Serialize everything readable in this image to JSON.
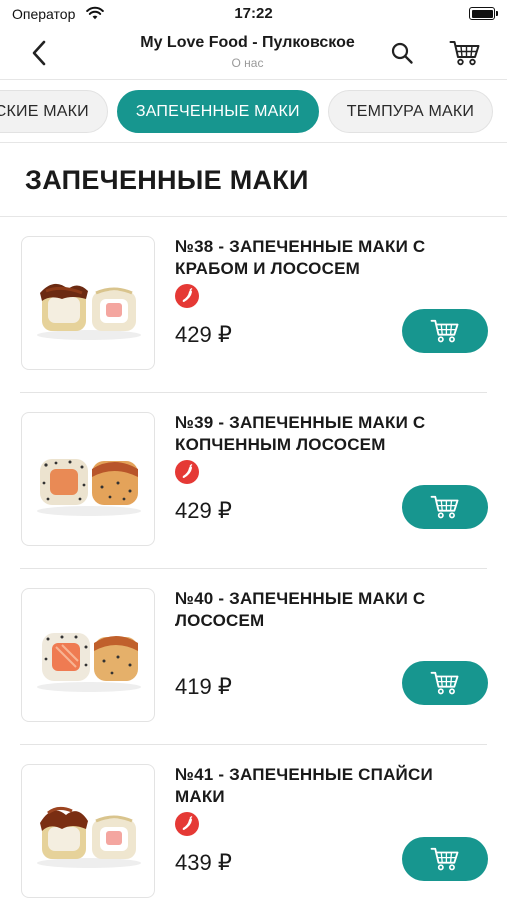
{
  "status_bar": {
    "carrier": "Оператор",
    "time": "17:22"
  },
  "header": {
    "title": "My Love Food - Пулковское",
    "subtitle": "О нас"
  },
  "categories": [
    {
      "label": "ЧЕСКИЕ МАКИ",
      "active": false
    },
    {
      "label": "ЗАПЕЧЕННЫЕ МАКИ",
      "active": true
    },
    {
      "label": "ТЕМПУРА МАКИ",
      "active": false
    }
  ],
  "section": {
    "title": "ЗАПЕЧЕННЫЕ МАКИ"
  },
  "colors": {
    "accent": "#17968f",
    "spicy_badge": "#e53935"
  },
  "products": [
    {
      "name": "№38 - ЗАПЕЧЕННЫЕ МАКИ С КРАБОМ И ЛОСОСЕМ",
      "price": "429 ₽",
      "spicy": true,
      "spicy_icon": "chili-icon",
      "image": "baked-maki-crab-salmon"
    },
    {
      "name": "№39 - ЗАПЕЧЕННЫЕ МАКИ С КОПЧЕННЫМ ЛОСОСЕМ",
      "price": "429 ₽",
      "spicy": true,
      "spicy_icon": "chili-icon",
      "image": "baked-maki-smoked-salmon"
    },
    {
      "name": "№40 - ЗАПЕЧЕННЫЕ МАКИ С ЛОСОСЕМ",
      "price": "419 ₽",
      "spicy": false,
      "image": "baked-maki-salmon"
    },
    {
      "name": "№41 - ЗАПЕЧЕННЫЕ СПАЙСИ МАКИ",
      "price": "439 ₽",
      "spicy": true,
      "spicy_icon": "chili-icon",
      "image": "baked-spicy-maki"
    }
  ],
  "icons": {
    "back": "chevron-left-icon",
    "search": "search-icon",
    "cart": "cart-icon",
    "add_to_cart": "add-to-cart-icon"
  }
}
